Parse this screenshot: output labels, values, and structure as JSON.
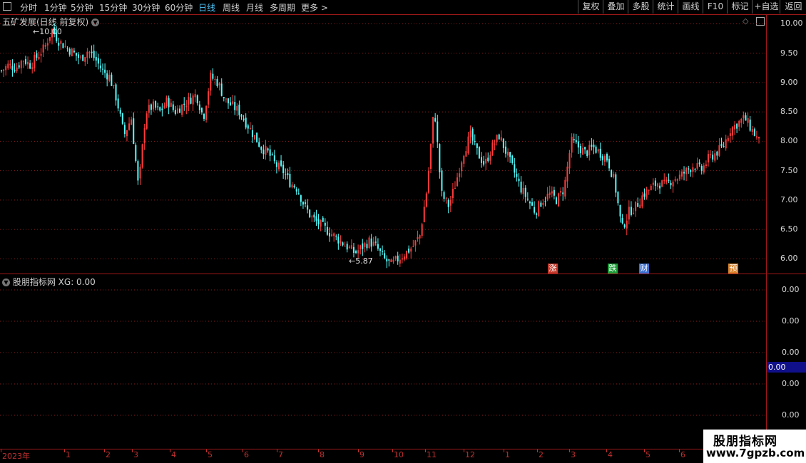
{
  "toolbar": {
    "timeframes": [
      "分时",
      "1分钟",
      "5分钟",
      "15分钟",
      "30分钟",
      "60分钟",
      "日线",
      "周线",
      "月线",
      "多周期",
      "更多 >"
    ],
    "active": "日线",
    "right_buttons": [
      "复权",
      "叠加",
      "多股",
      "统计",
      "画线",
      "F10",
      "标记",
      "+自选",
      "返回"
    ]
  },
  "main_panel": {
    "title": "五矿发展(日线 前复权)",
    "high_label": "10.00",
    "low_label": "5.87",
    "y_ticks": [
      "10.00",
      "9.50",
      "9.00",
      "8.50",
      "8.00",
      "7.50",
      "7.00",
      "6.50",
      "6.00"
    ],
    "badges": [
      {
        "text": "涨",
        "color": "#c0392b"
      },
      {
        "text": "跌",
        "color": "#1e9e3a"
      },
      {
        "text": "财",
        "color": "#3a6fd0"
      },
      {
        "text": "预",
        "color": "#d9822b"
      }
    ]
  },
  "indicator_panel": {
    "title": "股朋指标网",
    "xg_label": "XG: 0.00",
    "y_ticks": [
      "0.00",
      "0.00",
      "0.00",
      "0.00",
      "0.00"
    ],
    "current_value": "0.00"
  },
  "x_axis": {
    "labels": [
      "2023年",
      "1",
      "2",
      "3",
      "4",
      "5",
      "6",
      "7",
      "8",
      "9",
      "10",
      "11",
      "12",
      "1",
      "2",
      "3",
      "4",
      "5",
      "6"
    ]
  },
  "watermark": {
    "line1": "股朋指标网",
    "line2": "www.7gpzb.com"
  },
  "colors": {
    "up": "#ff3b3b",
    "down": "#54ffff",
    "grid": "#8a1c1c",
    "accent": "#4fc3f7"
  },
  "chart_data": {
    "type": "candlestick",
    "title": "五矿发展(日线 前复权)",
    "ylim": [
      5.75,
      10.15
    ],
    "y_ticks": [
      6.0,
      6.5,
      7.0,
      7.5,
      8.0,
      8.5,
      9.0,
      9.5,
      10.0
    ],
    "annotated_high": 10.0,
    "annotated_low": 5.87,
    "closes": [
      9.2,
      9.3,
      9.25,
      9.4,
      9.3,
      9.45,
      9.6,
      9.9,
      9.7,
      9.6,
      9.5,
      9.4,
      9.55,
      9.4,
      9.2,
      9.1,
      8.7,
      8.1,
      8.4,
      7.2,
      8.5,
      8.6,
      8.5,
      8.7,
      8.5,
      8.6,
      8.7,
      8.8,
      8.4,
      9.1,
      9.0,
      8.7,
      8.6,
      8.5,
      8.3,
      8.1,
      7.9,
      7.8,
      7.6,
      7.5,
      7.3,
      7.2,
      6.9,
      6.7,
      6.6,
      6.5,
      6.4,
      6.3,
      6.2,
      6.1,
      6.2,
      6.3,
      6.2,
      6.0,
      5.9,
      6.0,
      6.1,
      6.2,
      6.4,
      7.2,
      8.6,
      7.1,
      6.9,
      7.3,
      7.8,
      8.1,
      7.8,
      7.6,
      7.9,
      8.1,
      7.8,
      7.5,
      7.2,
      7.0,
      6.8,
      7.0,
      7.1,
      7.0,
      7.2,
      8.0,
      7.9,
      7.8,
      7.9,
      7.8,
      7.7,
      7.3,
      6.5,
      6.8,
      6.9,
      7.1,
      7.2,
      7.3,
      7.25,
      7.35,
      7.4,
      7.5,
      7.6,
      7.5,
      7.7,
      7.8,
      7.9,
      8.2,
      8.3,
      8.4,
      8.2,
      8.0
    ]
  }
}
